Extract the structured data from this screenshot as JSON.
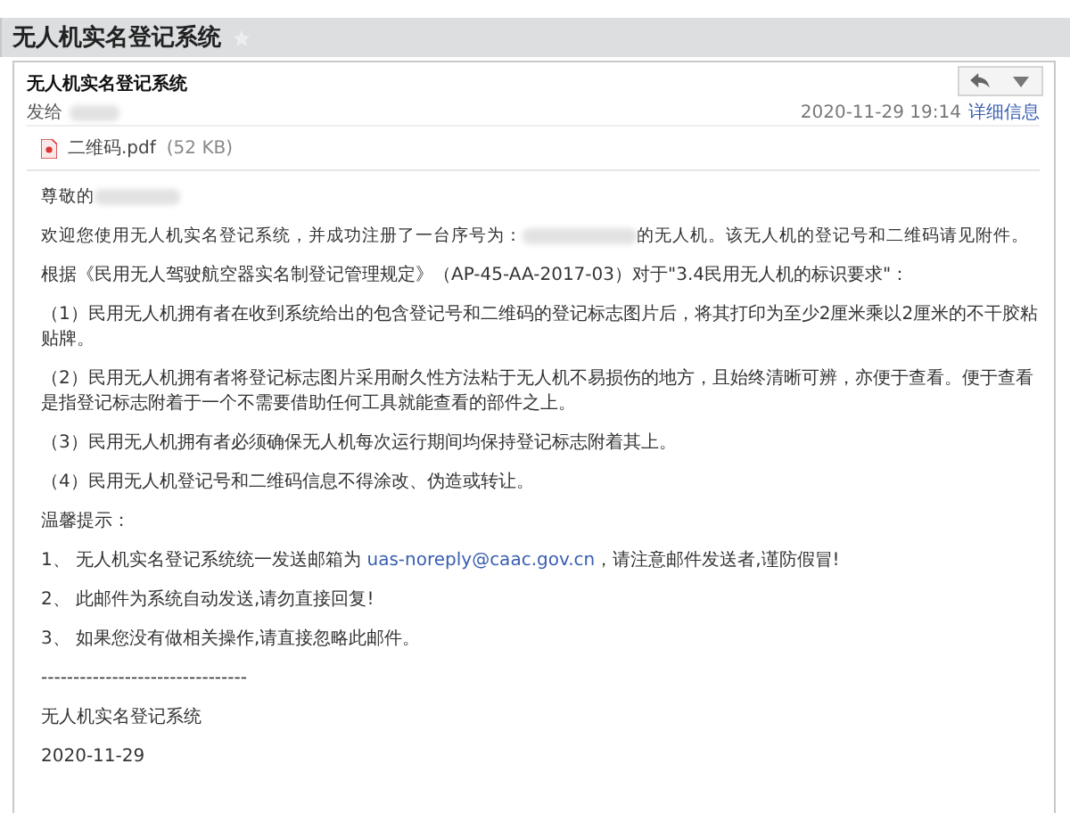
{
  "window": {
    "title": "无人机实名登记系统",
    "starred": false
  },
  "message": {
    "sender": "无人机实名登记系统",
    "to_label": "发给",
    "date": "2020-11-29 19:14",
    "details_link": "详细信息"
  },
  "attachment": {
    "name": "二维码.pdf",
    "size": "(52 KB)"
  },
  "body": [
    {
      "kind": "redacted",
      "before": "尊敬的"
    },
    {
      "kind": "redacted",
      "before": "欢迎您使用无人机实名登记系统，并成功注册了一台序号为：",
      "after": "的无人机。该无人机的登记号和二维码请见附件。"
    },
    {
      "kind": "plain",
      "text": "根据《民用无人驾驶航空器实名制登记管理规定》（AP-45-AA-2017-03）对于\"3.4民用无人机的标识要求\"："
    },
    {
      "kind": "plain",
      "text": "（1）民用无人机拥有者在收到系统给出的包含登记号和二维码的登记标志图片后，将其打印为至少2厘米乘以2厘米的不干胶粘贴牌。"
    },
    {
      "kind": "plain",
      "text": "（2）民用无人机拥有者将登记标志图片采用耐久性方法粘于无人机不易损伤的地方，且始终清晰可辨，亦便于查看。便于查看是指登记标志附着于一个不需要借助任何工具就能查看的部件之上。"
    },
    {
      "kind": "plain",
      "text": "（3）民用无人机拥有者必须确保无人机每次运行期间均保持登记标志附着其上。"
    },
    {
      "kind": "plain",
      "text": "（4）民用无人机登记号和二维码信息不得涂改、伪造或转让。"
    },
    {
      "kind": "plain",
      "text": "温馨提示："
    },
    {
      "kind": "link",
      "before": "1、 无人机实名登记系统统一发送邮箱为 ",
      "link": "uas-noreply@caac.gov.cn",
      "after": "，请注意邮件发送者,谨防假冒!"
    },
    {
      "kind": "plain",
      "text": "2、 此邮件为系统自动发送,请勿直接回复!"
    },
    {
      "kind": "plain",
      "text": "3、 如果您没有做相关操作,请直接忽略此邮件。"
    },
    {
      "kind": "plain",
      "text": "--------------------------------"
    },
    {
      "kind": "plain",
      "text": "无人机实名登记系统"
    },
    {
      "kind": "plain",
      "text": "2020-11-29"
    }
  ]
}
